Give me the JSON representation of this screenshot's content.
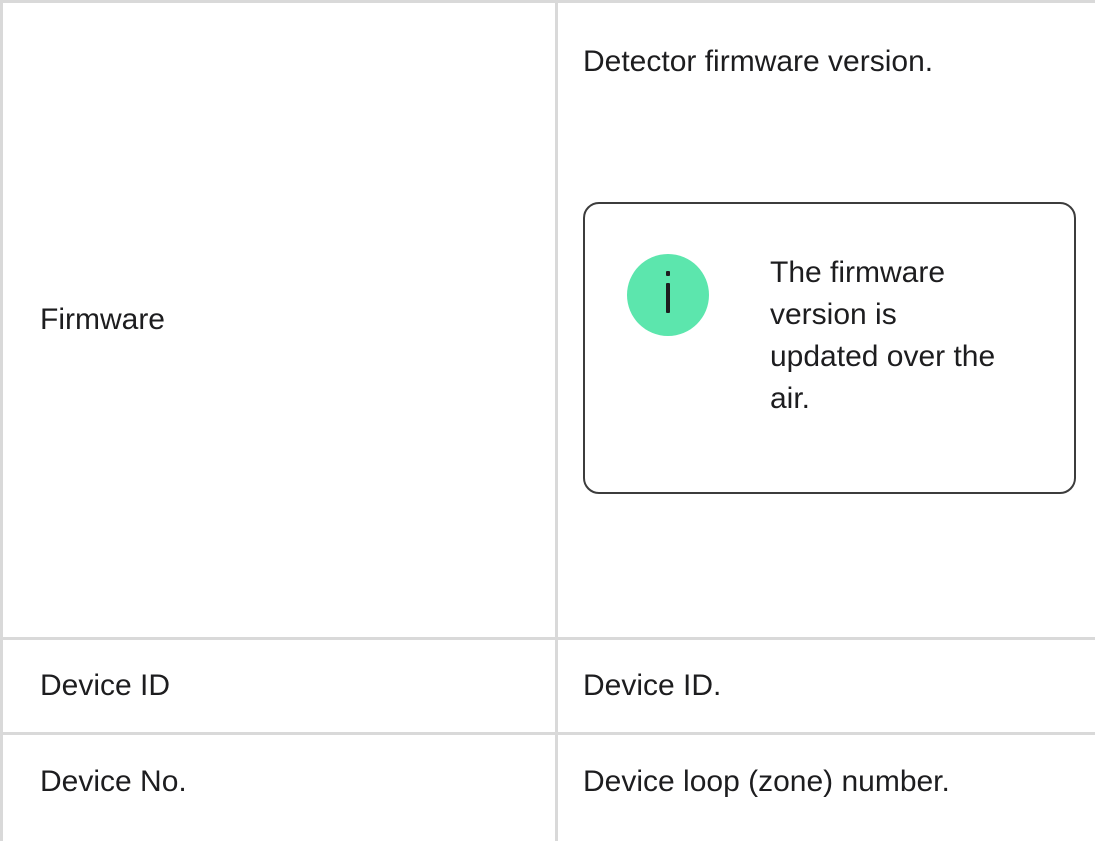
{
  "rows": {
    "firmware": {
      "label": "Firmware",
      "description": "Detector firmware version.",
      "note": {
        "icon": "info-icon",
        "icon_color": "#5ce6ad",
        "text": "The firmware version is updated over the air."
      }
    },
    "device_id": {
      "label": "Device ID",
      "description": "Device ID."
    },
    "device_no": {
      "label": "Device No.",
      "description": "Device loop (zone) number."
    }
  },
  "colors": {
    "border": "#d9d9d9",
    "text": "#1d1d1f",
    "note_border": "#3c3c3c"
  }
}
